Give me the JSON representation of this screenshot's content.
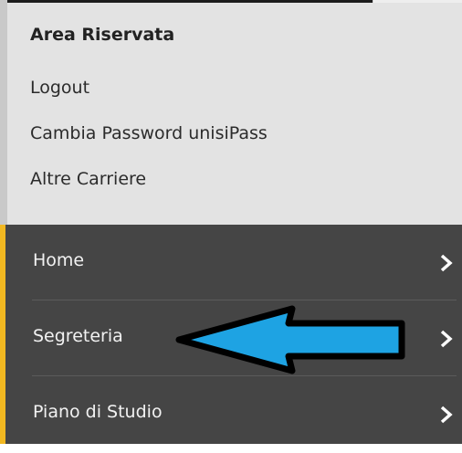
{
  "account": {
    "title": "Area Riservata",
    "links": [
      {
        "label": "Logout"
      },
      {
        "label": "Cambia Password unisiPass"
      },
      {
        "label": "Altre Carriere"
      }
    ]
  },
  "menu": {
    "items": [
      {
        "label": "Home"
      },
      {
        "label": "Segreteria"
      },
      {
        "label": "Piano di Studio"
      }
    ]
  },
  "annotation": {
    "arrow_color": "#1ea3e3",
    "points_to": "Segreteria"
  },
  "colors": {
    "menu_bg": "#454545",
    "accent": "#f2b821",
    "account_bg": "#e3e3e3"
  }
}
